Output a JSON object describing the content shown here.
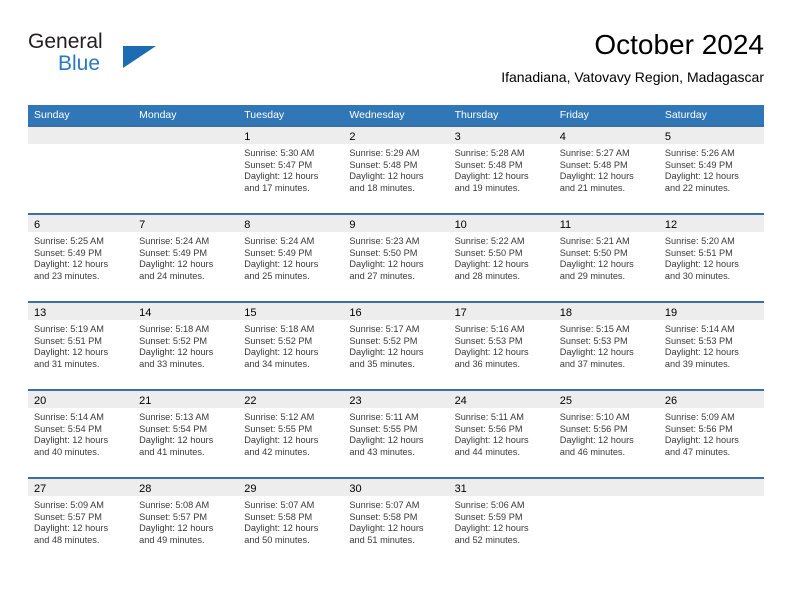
{
  "brand": {
    "word_general": "General",
    "word_blue": "Blue",
    "triangle_color": "#1c6cb3",
    "blue_text_color": "#2b79c2"
  },
  "header": {
    "title": "October 2024",
    "subtitle": "Ifanadiana, Vatovavy Region, Madagascar"
  },
  "theme": {
    "header_bar_color": "#3077b7",
    "row_divider_color": "#3a6fa3",
    "day_band_color": "#ededed",
    "detail_text_color": "#3a3a3a"
  },
  "calendar": {
    "day_headers": [
      "Sunday",
      "Monday",
      "Tuesday",
      "Wednesday",
      "Thursday",
      "Friday",
      "Saturday"
    ],
    "weeks": [
      [
        {
          "day": "",
          "empty": true
        },
        {
          "day": "",
          "empty": true
        },
        {
          "day": "1",
          "sunrise": "Sunrise: 5:30 AM",
          "sunset": "Sunset: 5:47 PM",
          "daylight_1": "Daylight: 12 hours",
          "daylight_2": "and 17 minutes."
        },
        {
          "day": "2",
          "sunrise": "Sunrise: 5:29 AM",
          "sunset": "Sunset: 5:48 PM",
          "daylight_1": "Daylight: 12 hours",
          "daylight_2": "and 18 minutes."
        },
        {
          "day": "3",
          "sunrise": "Sunrise: 5:28 AM",
          "sunset": "Sunset: 5:48 PM",
          "daylight_1": "Daylight: 12 hours",
          "daylight_2": "and 19 minutes."
        },
        {
          "day": "4",
          "sunrise": "Sunrise: 5:27 AM",
          "sunset": "Sunset: 5:48 PM",
          "daylight_1": "Daylight: 12 hours",
          "daylight_2": "and 21 minutes."
        },
        {
          "day": "5",
          "sunrise": "Sunrise: 5:26 AM",
          "sunset": "Sunset: 5:49 PM",
          "daylight_1": "Daylight: 12 hours",
          "daylight_2": "and 22 minutes."
        }
      ],
      [
        {
          "day": "6",
          "sunrise": "Sunrise: 5:25 AM",
          "sunset": "Sunset: 5:49 PM",
          "daylight_1": "Daylight: 12 hours",
          "daylight_2": "and 23 minutes."
        },
        {
          "day": "7",
          "sunrise": "Sunrise: 5:24 AM",
          "sunset": "Sunset: 5:49 PM",
          "daylight_1": "Daylight: 12 hours",
          "daylight_2": "and 24 minutes."
        },
        {
          "day": "8",
          "sunrise": "Sunrise: 5:24 AM",
          "sunset": "Sunset: 5:49 PM",
          "daylight_1": "Daylight: 12 hours",
          "daylight_2": "and 25 minutes."
        },
        {
          "day": "9",
          "sunrise": "Sunrise: 5:23 AM",
          "sunset": "Sunset: 5:50 PM",
          "daylight_1": "Daylight: 12 hours",
          "daylight_2": "and 27 minutes."
        },
        {
          "day": "10",
          "sunrise": "Sunrise: 5:22 AM",
          "sunset": "Sunset: 5:50 PM",
          "daylight_1": "Daylight: 12 hours",
          "daylight_2": "and 28 minutes."
        },
        {
          "day": "11",
          "sunrise": "Sunrise: 5:21 AM",
          "sunset": "Sunset: 5:50 PM",
          "daylight_1": "Daylight: 12 hours",
          "daylight_2": "and 29 minutes."
        },
        {
          "day": "12",
          "sunrise": "Sunrise: 5:20 AM",
          "sunset": "Sunset: 5:51 PM",
          "daylight_1": "Daylight: 12 hours",
          "daylight_2": "and 30 minutes."
        }
      ],
      [
        {
          "day": "13",
          "sunrise": "Sunrise: 5:19 AM",
          "sunset": "Sunset: 5:51 PM",
          "daylight_1": "Daylight: 12 hours",
          "daylight_2": "and 31 minutes."
        },
        {
          "day": "14",
          "sunrise": "Sunrise: 5:18 AM",
          "sunset": "Sunset: 5:52 PM",
          "daylight_1": "Daylight: 12 hours",
          "daylight_2": "and 33 minutes."
        },
        {
          "day": "15",
          "sunrise": "Sunrise: 5:18 AM",
          "sunset": "Sunset: 5:52 PM",
          "daylight_1": "Daylight: 12 hours",
          "daylight_2": "and 34 minutes."
        },
        {
          "day": "16",
          "sunrise": "Sunrise: 5:17 AM",
          "sunset": "Sunset: 5:52 PM",
          "daylight_1": "Daylight: 12 hours",
          "daylight_2": "and 35 minutes."
        },
        {
          "day": "17",
          "sunrise": "Sunrise: 5:16 AM",
          "sunset": "Sunset: 5:53 PM",
          "daylight_1": "Daylight: 12 hours",
          "daylight_2": "and 36 minutes."
        },
        {
          "day": "18",
          "sunrise": "Sunrise: 5:15 AM",
          "sunset": "Sunset: 5:53 PM",
          "daylight_1": "Daylight: 12 hours",
          "daylight_2": "and 37 minutes."
        },
        {
          "day": "19",
          "sunrise": "Sunrise: 5:14 AM",
          "sunset": "Sunset: 5:53 PM",
          "daylight_1": "Daylight: 12 hours",
          "daylight_2": "and 39 minutes."
        }
      ],
      [
        {
          "day": "20",
          "sunrise": "Sunrise: 5:14 AM",
          "sunset": "Sunset: 5:54 PM",
          "daylight_1": "Daylight: 12 hours",
          "daylight_2": "and 40 minutes."
        },
        {
          "day": "21",
          "sunrise": "Sunrise: 5:13 AM",
          "sunset": "Sunset: 5:54 PM",
          "daylight_1": "Daylight: 12 hours",
          "daylight_2": "and 41 minutes."
        },
        {
          "day": "22",
          "sunrise": "Sunrise: 5:12 AM",
          "sunset": "Sunset: 5:55 PM",
          "daylight_1": "Daylight: 12 hours",
          "daylight_2": "and 42 minutes."
        },
        {
          "day": "23",
          "sunrise": "Sunrise: 5:11 AM",
          "sunset": "Sunset: 5:55 PM",
          "daylight_1": "Daylight: 12 hours",
          "daylight_2": "and 43 minutes."
        },
        {
          "day": "24",
          "sunrise": "Sunrise: 5:11 AM",
          "sunset": "Sunset: 5:56 PM",
          "daylight_1": "Daylight: 12 hours",
          "daylight_2": "and 44 minutes."
        },
        {
          "day": "25",
          "sunrise": "Sunrise: 5:10 AM",
          "sunset": "Sunset: 5:56 PM",
          "daylight_1": "Daylight: 12 hours",
          "daylight_2": "and 46 minutes."
        },
        {
          "day": "26",
          "sunrise": "Sunrise: 5:09 AM",
          "sunset": "Sunset: 5:56 PM",
          "daylight_1": "Daylight: 12 hours",
          "daylight_2": "and 47 minutes."
        }
      ],
      [
        {
          "day": "27",
          "sunrise": "Sunrise: 5:09 AM",
          "sunset": "Sunset: 5:57 PM",
          "daylight_1": "Daylight: 12 hours",
          "daylight_2": "and 48 minutes."
        },
        {
          "day": "28",
          "sunrise": "Sunrise: 5:08 AM",
          "sunset": "Sunset: 5:57 PM",
          "daylight_1": "Daylight: 12 hours",
          "daylight_2": "and 49 minutes."
        },
        {
          "day": "29",
          "sunrise": "Sunrise: 5:07 AM",
          "sunset": "Sunset: 5:58 PM",
          "daylight_1": "Daylight: 12 hours",
          "daylight_2": "and 50 minutes."
        },
        {
          "day": "30",
          "sunrise": "Sunrise: 5:07 AM",
          "sunset": "Sunset: 5:58 PM",
          "daylight_1": "Daylight: 12 hours",
          "daylight_2": "and 51 minutes."
        },
        {
          "day": "31",
          "sunrise": "Sunrise: 5:06 AM",
          "sunset": "Sunset: 5:59 PM",
          "daylight_1": "Daylight: 12 hours",
          "daylight_2": "and 52 minutes."
        },
        {
          "day": "",
          "empty": true
        },
        {
          "day": "",
          "empty": true
        }
      ]
    ]
  }
}
